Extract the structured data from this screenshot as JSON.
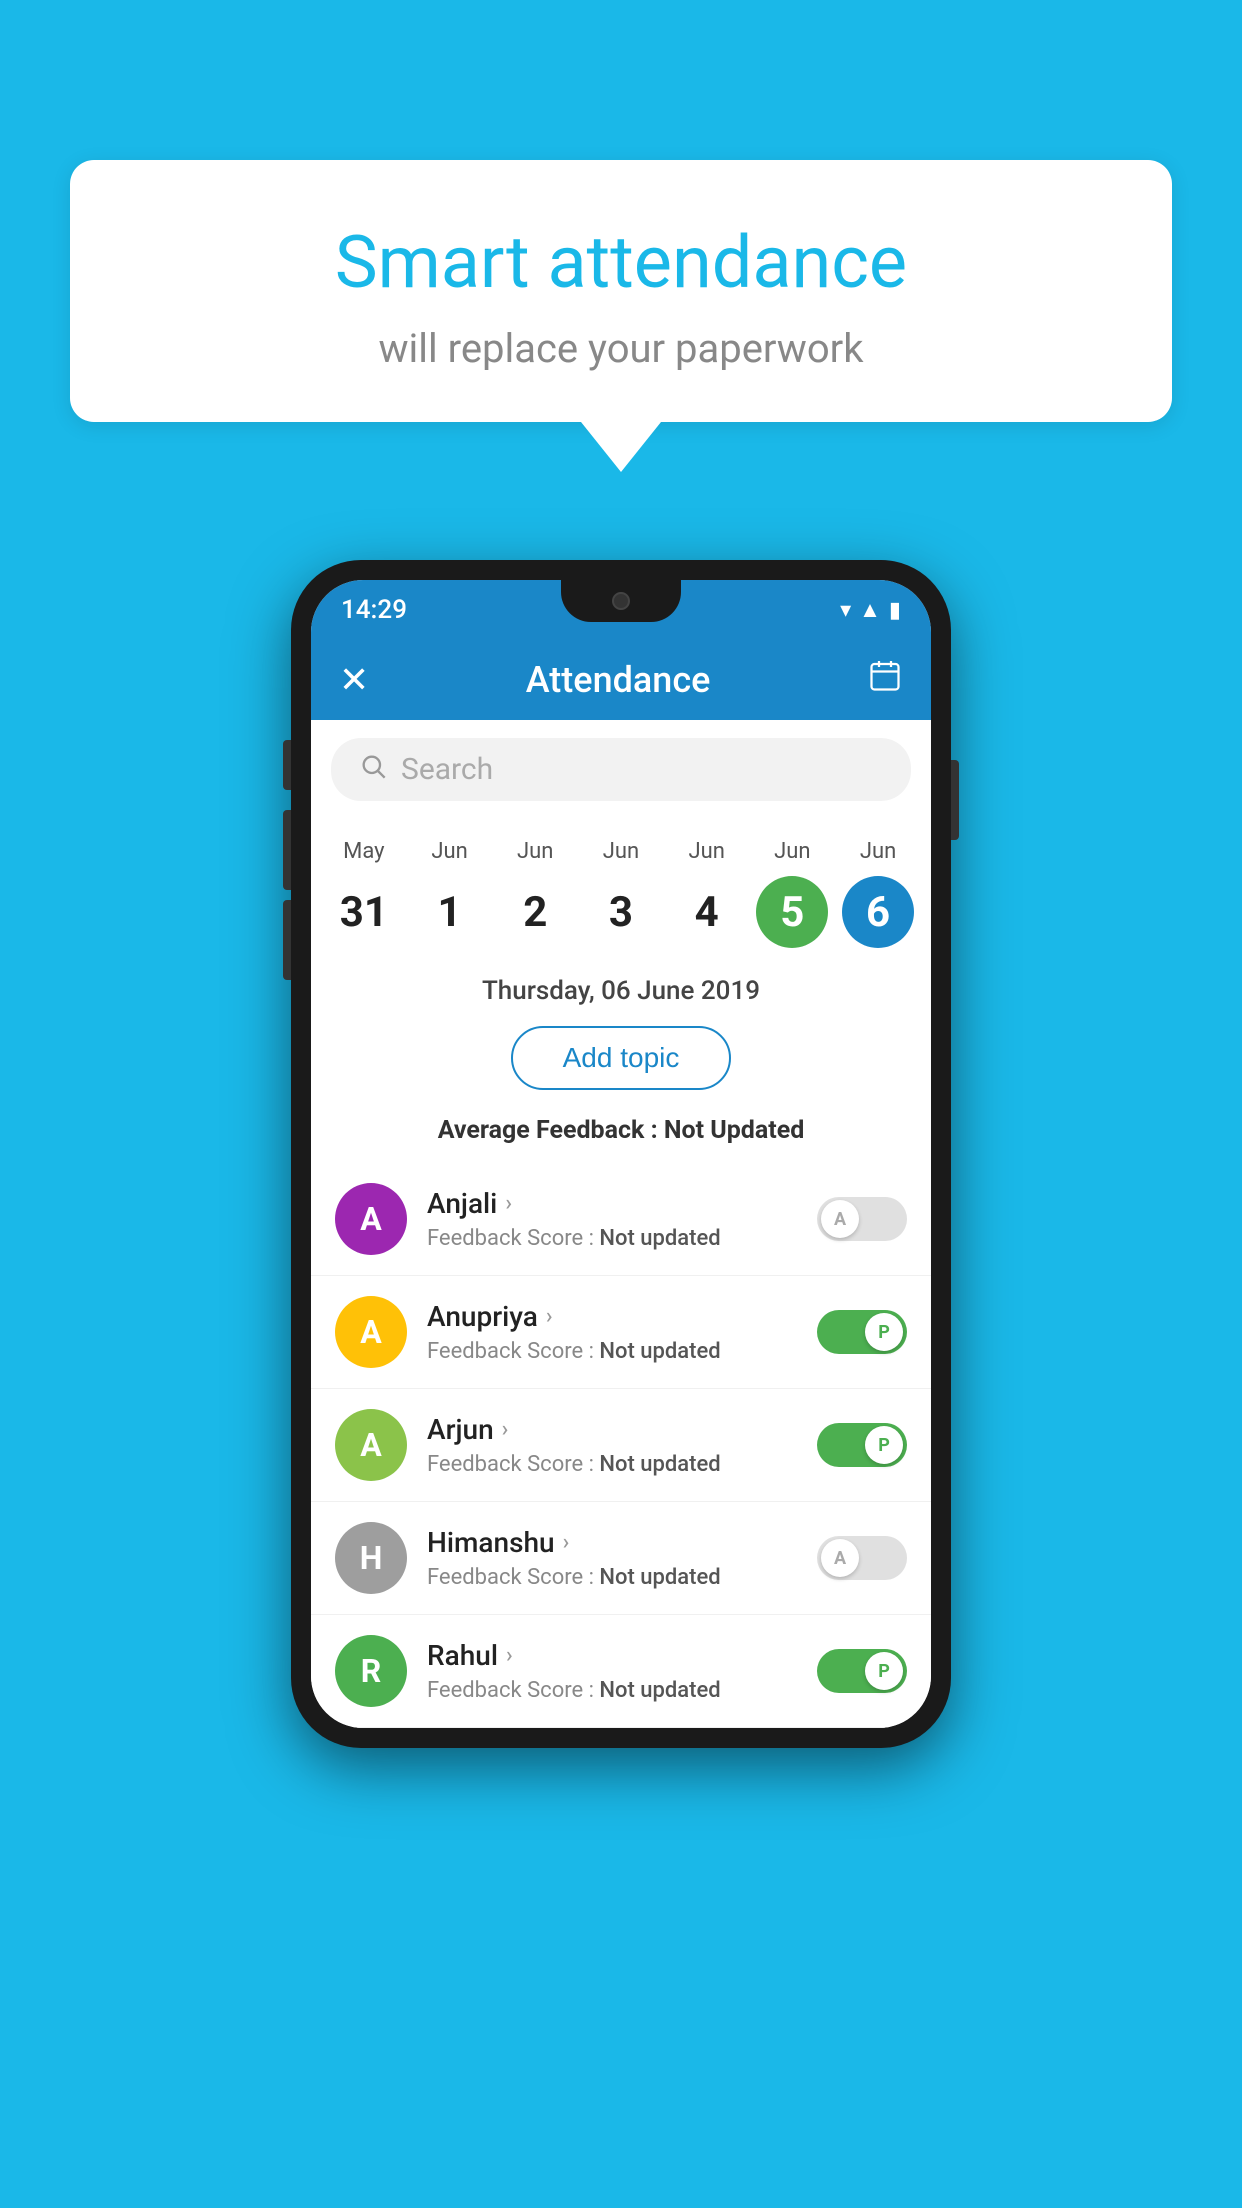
{
  "background_color": "#1AB8E8",
  "speech_bubble": {
    "title": "Smart attendance",
    "subtitle": "will replace your paperwork"
  },
  "phone": {
    "status_bar": {
      "time": "14:29",
      "icons": [
        "wifi",
        "signal",
        "battery"
      ]
    },
    "header": {
      "title": "Attendance",
      "close_icon": "✕",
      "calendar_icon": "📅"
    },
    "search": {
      "placeholder": "Search"
    },
    "calendar": {
      "days": [
        {
          "month": "May",
          "date": "31",
          "state": "normal"
        },
        {
          "month": "Jun",
          "date": "1",
          "state": "normal"
        },
        {
          "month": "Jun",
          "date": "2",
          "state": "normal"
        },
        {
          "month": "Jun",
          "date": "3",
          "state": "normal"
        },
        {
          "month": "Jun",
          "date": "4",
          "state": "normal"
        },
        {
          "month": "Jun",
          "date": "5",
          "state": "today"
        },
        {
          "month": "Jun",
          "date": "6",
          "state": "selected"
        }
      ]
    },
    "selected_date": "Thursday, 06 June 2019",
    "add_topic_label": "Add topic",
    "avg_feedback_label": "Average Feedback :",
    "avg_feedback_value": "Not Updated",
    "students": [
      {
        "name": "Anjali",
        "avatar_letter": "A",
        "avatar_color": "#9C27B0",
        "feedback_label": "Feedback Score :",
        "feedback_value": "Not updated",
        "toggle": "off",
        "toggle_label": "A"
      },
      {
        "name": "Anupriya",
        "avatar_letter": "A",
        "avatar_color": "#FFC107",
        "feedback_label": "Feedback Score :",
        "feedback_value": "Not updated",
        "toggle": "on",
        "toggle_label": "P"
      },
      {
        "name": "Arjun",
        "avatar_letter": "A",
        "avatar_color": "#8BC34A",
        "feedback_label": "Feedback Score :",
        "feedback_value": "Not updated",
        "toggle": "on",
        "toggle_label": "P"
      },
      {
        "name": "Himanshu",
        "avatar_letter": "H",
        "avatar_color": "#9E9E9E",
        "feedback_label": "Feedback Score :",
        "feedback_value": "Not updated",
        "toggle": "off",
        "toggle_label": "A"
      },
      {
        "name": "Rahul",
        "avatar_letter": "R",
        "avatar_color": "#4CAF50",
        "feedback_label": "Feedback Score :",
        "feedback_value": "Not updated",
        "toggle": "on",
        "toggle_label": "P"
      }
    ]
  }
}
